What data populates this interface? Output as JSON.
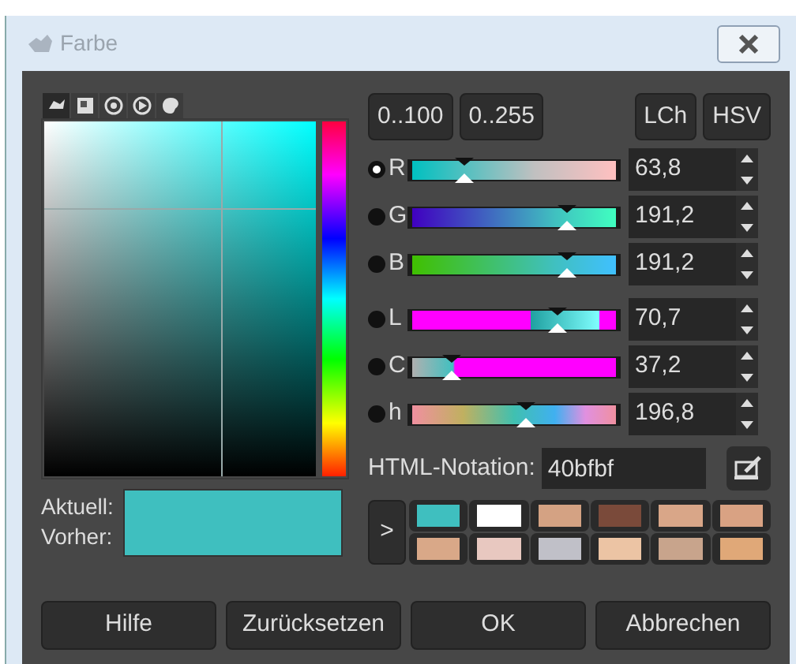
{
  "window": {
    "title": "Farbe"
  },
  "selector_tabs": [
    {
      "selected": true
    },
    {
      "selected": false
    },
    {
      "selected": false
    },
    {
      "selected": false
    },
    {
      "selected": false
    }
  ],
  "range_buttons": [
    "0..100",
    "0..255"
  ],
  "model_buttons": [
    "LCh",
    "HSV"
  ],
  "channels": [
    {
      "name": "R",
      "selected": true,
      "level": 0.25,
      "value": "63,8"
    },
    {
      "name": "G",
      "selected": false,
      "level": 0.75,
      "value": "191,2"
    },
    {
      "name": "B",
      "selected": false,
      "level": 0.75,
      "value": "191,2"
    },
    {
      "name": "L",
      "selected": false,
      "level": 0.707,
      "value": "70,7"
    },
    {
      "name": "C",
      "selected": false,
      "level": 0.186,
      "value": "37,2"
    },
    {
      "name": "h",
      "selected": false,
      "level": 0.547,
      "value": "196,8"
    }
  ],
  "html_notation": {
    "label": "HTML-Notation:",
    "value": "40bfbf"
  },
  "current": {
    "label": "Aktuell:",
    "color": "#3fbfbf"
  },
  "previous": {
    "label": "Vorher:",
    "color": "#3fbfbf"
  },
  "history_button": ">",
  "history": [
    {
      "color": "#3fbfbf"
    },
    {
      "color": "#ffffff"
    },
    {
      "color": "#d4a283"
    },
    {
      "color": "#7a4a3a"
    },
    {
      "color": "#d9a688"
    },
    {
      "color": "#d9a283"
    },
    {
      "color": "#d9a888"
    },
    {
      "color": "#e8c8c0"
    },
    {
      "color": "#c0c0c8"
    },
    {
      "color": "#ecc4a4"
    },
    {
      "color": "#c8a48c"
    },
    {
      "color": "#e0a878"
    }
  ],
  "buttons": [
    "Hilfe",
    "Zurücksetzen",
    "OK",
    "Abbrechen"
  ]
}
